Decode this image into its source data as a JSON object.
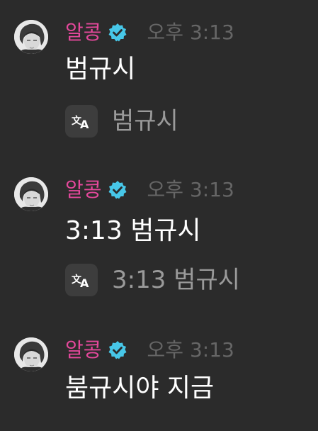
{
  "colors": {
    "background": "#2b2b2b",
    "username": "#e4489b",
    "verified_badge": "#47c7e8",
    "time": "#666666",
    "message_text": "#ffffff",
    "translation_text": "#9a9a9a"
  },
  "messages": [
    {
      "username": "알콩",
      "time": "오후 3:13",
      "text": "범규시",
      "translation": "범규시",
      "icons": {
        "avatar": "avatar-image",
        "verified": "verified-badge-icon",
        "translate": "translate-icon"
      }
    },
    {
      "username": "알콩",
      "time": "오후 3:13",
      "text": "3:13 범규시",
      "translation": "3:13 범규시",
      "icons": {
        "avatar": "avatar-image",
        "verified": "verified-badge-icon",
        "translate": "translate-icon"
      }
    },
    {
      "username": "알콩",
      "time": "오후 3:13",
      "text": "붐규시야 지금",
      "icons": {
        "avatar": "avatar-image",
        "verified": "verified-badge-icon"
      }
    }
  ]
}
